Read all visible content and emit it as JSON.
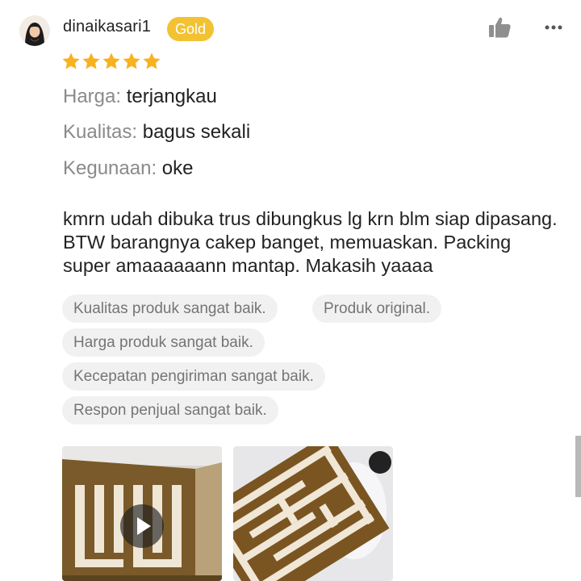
{
  "review": {
    "username": "dinaikasari1",
    "badge": "Gold",
    "rating": 5,
    "attributes": [
      {
        "label": "Harga:",
        "value": "terjangkau"
      },
      {
        "label": "Kualitas:",
        "value": "bagus sekali"
      },
      {
        "label": "Kegunaan:",
        "value": "oke"
      }
    ],
    "text": "kmrn udah dibuka trus dibungkus lg krn blm siap dipasang. BTW barangnya cakep banget, memuaskan. Packing super amaaaaaann mantap. Makasih yaaaa",
    "tags": [
      "Kualitas produk sangat baik.",
      "Produk original.",
      "Harga produk sangat baik.",
      "Kecepatan pengiriman sangat baik.",
      "Respon penjual sangat baik."
    ],
    "media": [
      {
        "type": "video",
        "icon": "play-icon"
      },
      {
        "type": "photo"
      }
    ]
  },
  "icons": {
    "like": "thumbs-up-icon",
    "more": "more-options-icon",
    "star": "star-icon"
  },
  "colors": {
    "badge": "#f2c233",
    "star": "#f8b21f",
    "chip_bg": "#f1f1f1",
    "label_gray": "#8a8a8a"
  }
}
